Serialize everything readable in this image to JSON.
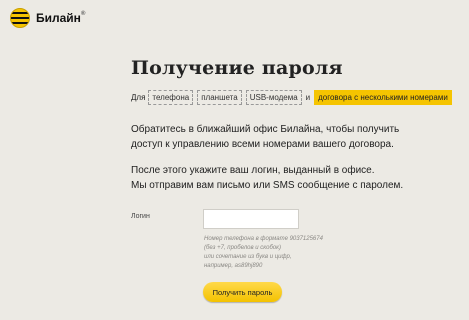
{
  "brand": {
    "name": "Билайн",
    "trademark": "®"
  },
  "title": "Получение пароля",
  "devices": {
    "prefix": "Для",
    "options": [
      "телефона",
      "планшета",
      "USB-модема"
    ],
    "separator": "и",
    "active": "договора с несколькими номерами",
    "accent": "#f5c400"
  },
  "paragraph1": [
    "Обратитесь в ближайший офис Билайна, чтобы получить",
    "доступ к управлению всеми номерами вашего договора."
  ],
  "paragraph2": [
    "После этого укажите ваш логин, выданный в офисе.",
    "Мы отправим вам письмо или SMS сообщение с паролем."
  ],
  "login": {
    "label": "Логин",
    "value": "",
    "hint": [
      "Номер телефона в формате 9037125674",
      "(без +7, пробелов и скобок)",
      "или сочетание из букв и цифр,",
      "например, as89hj890"
    ]
  },
  "submit_label": "Получить пароль"
}
